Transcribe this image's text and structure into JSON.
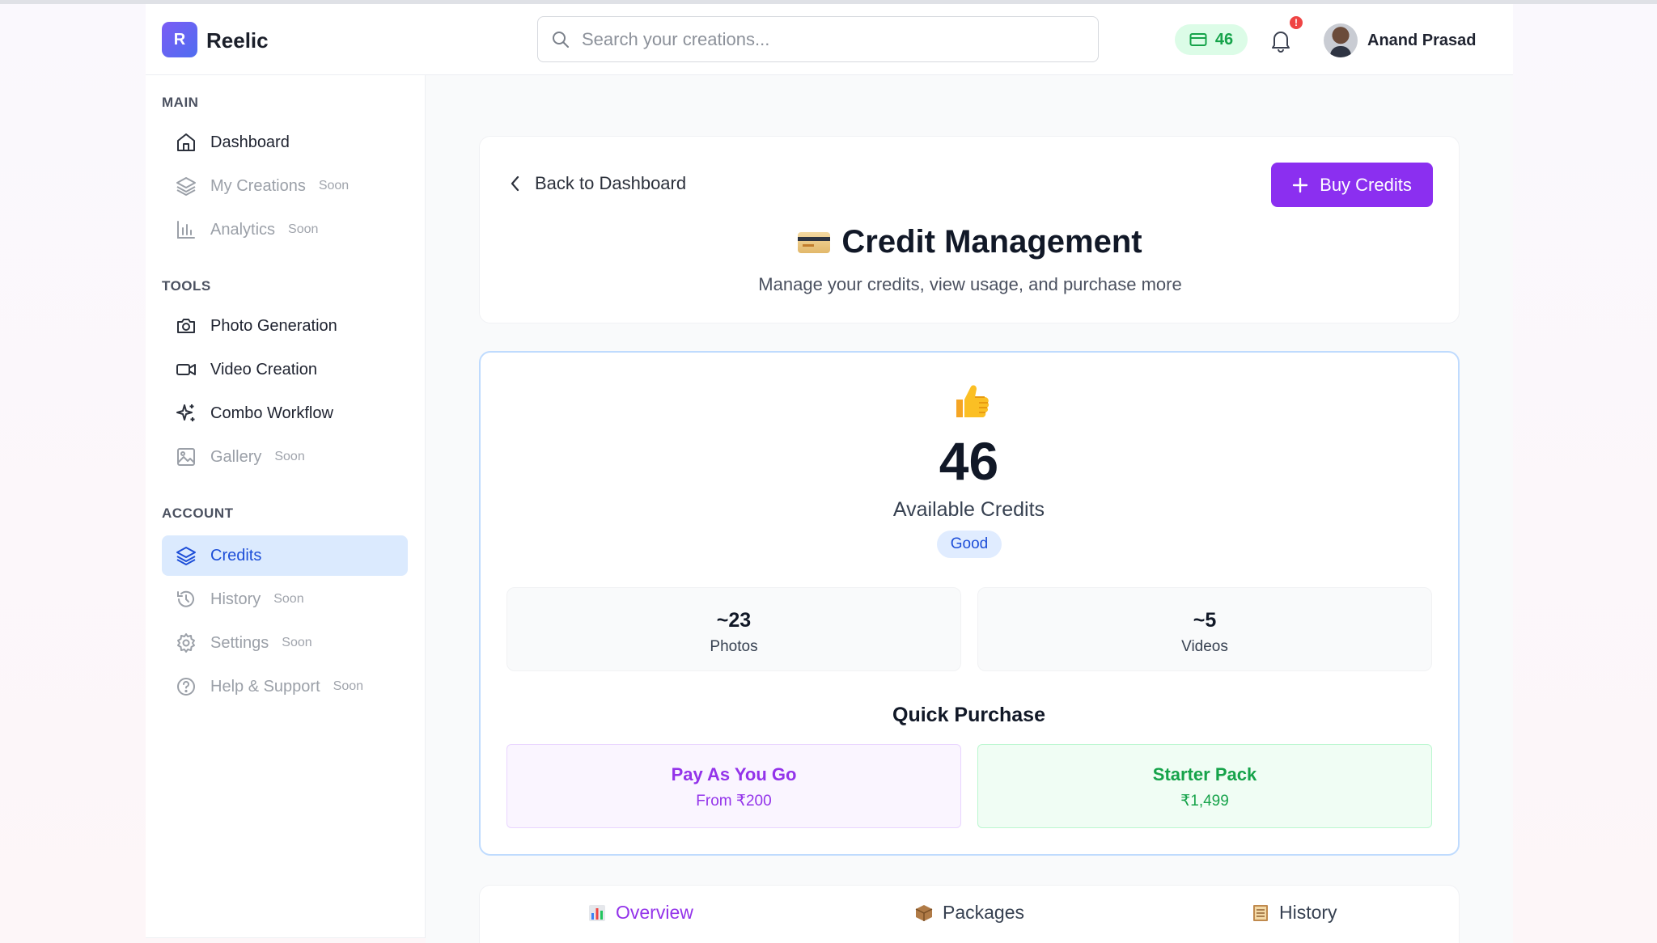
{
  "app": {
    "logo_letter": "R",
    "name": "Reelic"
  },
  "search": {
    "placeholder": "Search your creations..."
  },
  "header": {
    "credits": "46",
    "notification_badge": "!",
    "user_name": "Anand Prasad"
  },
  "sidebar": {
    "sections": [
      {
        "title": "MAIN"
      },
      {
        "title": "TOOLS"
      },
      {
        "title": "ACCOUNT"
      }
    ],
    "items": [
      {
        "label": "Dashboard",
        "soon": ""
      },
      {
        "label": "My Creations",
        "soon": "Soon"
      },
      {
        "label": "Analytics",
        "soon": "Soon"
      },
      {
        "label": "Photo Generation",
        "soon": ""
      },
      {
        "label": "Video Creation",
        "soon": ""
      },
      {
        "label": "Combo Workflow",
        "soon": ""
      },
      {
        "label": "Gallery",
        "soon": "Soon"
      },
      {
        "label": "Credits",
        "soon": ""
      },
      {
        "label": "History",
        "soon": "Soon"
      },
      {
        "label": "Settings",
        "soon": "Soon"
      },
      {
        "label": "Help & Support",
        "soon": "Soon"
      }
    ]
  },
  "page": {
    "back_label": "Back to Dashboard",
    "buy_label": "Buy Credits",
    "title": "Credit Management",
    "subtitle": "Manage your credits, view usage, and purchase more"
  },
  "credits": {
    "available": "46",
    "available_label": "Available Credits",
    "status": "Good",
    "estimates": [
      {
        "value": "~23",
        "label": "Photos"
      },
      {
        "value": "~5",
        "label": "Videos"
      }
    ]
  },
  "quick_purchase": {
    "title": "Quick Purchase",
    "options": [
      {
        "title": "Pay As You Go",
        "price": "From ₹200"
      },
      {
        "title": "Starter Pack",
        "price": "₹1,499"
      }
    ]
  },
  "tabs": [
    {
      "label": "Overview",
      "icon": "bar-chart-icon"
    },
    {
      "label": "Packages",
      "icon": "package-icon"
    },
    {
      "label": "History",
      "icon": "ledger-icon"
    }
  ],
  "colors": {
    "accent": "#8b2ff0",
    "active_nav": "#dbeafe",
    "credits_green": "#16a34a"
  }
}
